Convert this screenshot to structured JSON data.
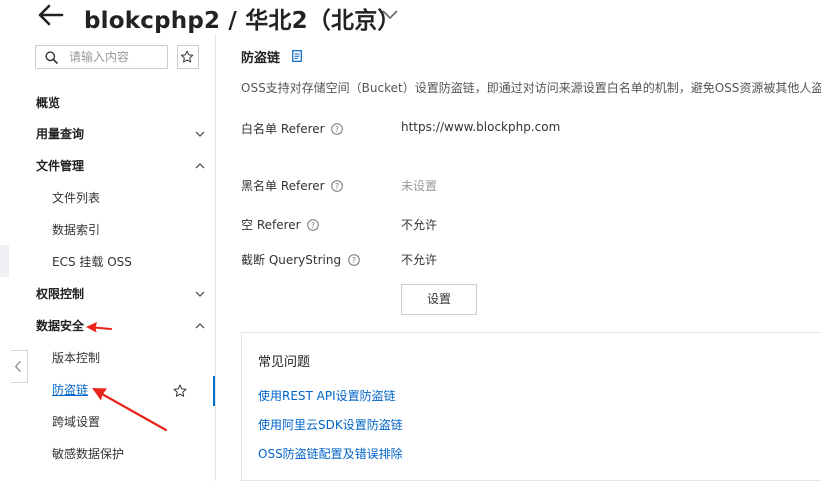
{
  "header": {
    "title": "blokcphp2 / 华北2（北京）"
  },
  "sidebar": {
    "search_placeholder": "请输入内容",
    "items": [
      {
        "label": "概览"
      },
      {
        "label": "用量查询"
      },
      {
        "label": "文件管理"
      },
      {
        "label": "文件列表"
      },
      {
        "label": "数据索引"
      },
      {
        "label": "ECS 挂载 OSS"
      },
      {
        "label": "权限控制"
      },
      {
        "label": "数据安全"
      },
      {
        "label": "版本控制"
      },
      {
        "label": "防盗链"
      },
      {
        "label": "跨域设置"
      },
      {
        "label": "敏感数据保护"
      }
    ]
  },
  "main": {
    "section_title": "防盗链",
    "description": "OSS支持对存储空间（Bucket）设置防盗链，即通过对访问来源设置白名单的机制，避免OSS资源被其他人盗用",
    "settings": [
      {
        "label": "白名单 Referer",
        "value": "https://www.blockphp.com"
      },
      {
        "label": "黑名单 Referer",
        "value": "未设置"
      },
      {
        "label": "空 Referer",
        "value": "不允许"
      },
      {
        "label": "截断 QueryString",
        "value": "不允许"
      }
    ],
    "setting_button": "设置",
    "faq": {
      "title": "常见问题",
      "links": [
        "使用REST API设置防盗链",
        "使用阿里云SDK设置防盗链",
        "OSS防盗链配置及错误排除"
      ]
    }
  },
  "colors": {
    "link": "#0064c8",
    "annotation_arrow": "#e8231a",
    "active_bar": "#0070cc"
  }
}
